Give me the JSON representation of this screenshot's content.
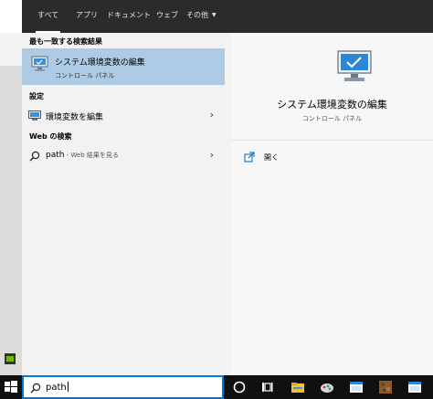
{
  "tabs": [
    {
      "label": "すべて",
      "active": true
    },
    {
      "label": "アプリ"
    },
    {
      "label": "ドキュメント"
    },
    {
      "label": "ウェブ"
    },
    {
      "label": "その他",
      "dropdown": true
    }
  ],
  "results": {
    "best_match_heading": "最も一致する検索結果",
    "best_match": {
      "title": "システム環境変数の編集",
      "subtitle": "コントロール パネル"
    },
    "settings_heading": "設定",
    "settings_item": "環境変数を編集",
    "web_heading": "Web の検索",
    "web_item": {
      "query": "path",
      "hint": " - Web 結果を見る"
    }
  },
  "preview": {
    "title": "システム環境変数の編集",
    "subtitle": "コントロール パネル",
    "open_label": "開く"
  },
  "search": {
    "value": "path"
  },
  "colors": {
    "topbar": "#2b2b2b",
    "selection": "#aecbe6",
    "accent": "#0078d7",
    "taskbar": "#101010"
  },
  "icons": {
    "start": "windows-start-icon",
    "search": "magnifier-icon",
    "result": "monitor-icon",
    "open": "open-external-icon"
  }
}
